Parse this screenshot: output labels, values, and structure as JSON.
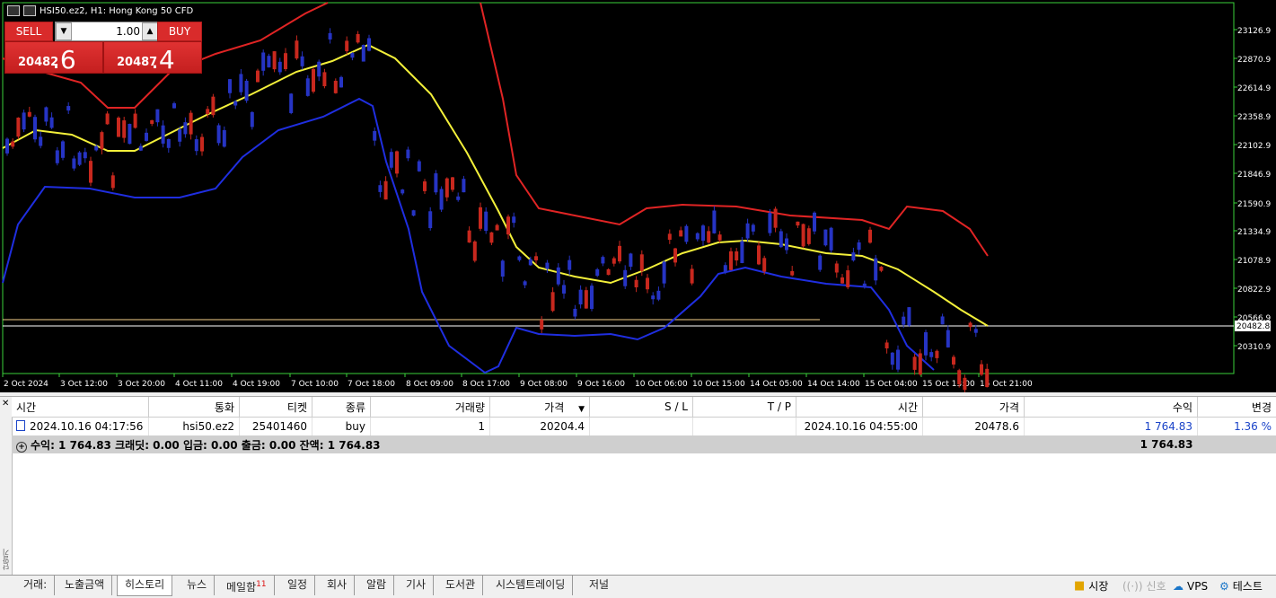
{
  "chart": {
    "title": "HSI50.ez2, H1:  Hong Kong 50 CFD",
    "price_labels": [
      "23126.9",
      "22870.9",
      "22614.9",
      "22358.9",
      "22102.9",
      "21846.9",
      "21590.9",
      "21334.9",
      "21078.9",
      "20822.9",
      "20566.9",
      "20310.9"
    ],
    "current_price_label": "20482.8",
    "time_labels": [
      "2 Oct 2024",
      "3 Oct 12:00",
      "3 Oct 20:00",
      "4 Oct 11:00",
      "4 Oct 19:00",
      "7 Oct 10:00",
      "7 Oct 18:00",
      "8 Oct 09:00",
      "8 Oct 17:00",
      "9 Oct 08:00",
      "9 Oct 16:00",
      "10 Oct 06:00",
      "10 Oct 15:00",
      "14 Oct 05:00",
      "14 Oct 14:00",
      "15 Oct 04:00",
      "15 Oct 13:00",
      "15 Oct 21:00"
    ],
    "colors": {
      "up": "#c8281e",
      "down": "#2634c4",
      "mid": "#f3f03a",
      "upper": "#e02424",
      "lower": "#1f2ee0",
      "grid_axis": "#3ad13a"
    }
  },
  "trade_panel": {
    "sell_label": "SELL",
    "buy_label": "BUY",
    "lot": "1.00",
    "sell_small": "20482",
    "sell_big": ".6",
    "buy_small": "20487",
    "buy_big": ".4"
  },
  "history_table": {
    "headers": [
      "시간",
      "통화",
      "티켓",
      "종류",
      "거래량",
      "가격",
      "S / L",
      "T / P",
      "시간",
      "가격",
      "수익",
      "변경"
    ],
    "row": {
      "time_open": "2024.10.16 04:17:56",
      "symbol": "hsi50.ez2",
      "ticket": "25401460",
      "type": "buy",
      "volume": "1",
      "price_open": "20204.4",
      "sl": "",
      "tp": "",
      "time_close": "2024.10.16 04:55:00",
      "price_close": "20478.6",
      "profit": "1 764.83",
      "change": "1.36 %"
    },
    "summary": "수익: 1 764.83  크래딧: 0.00  입금: 0.00  출금: 0.00  잔액: 1 764.83",
    "summary_total": "1 764.83"
  },
  "tabs": [
    "거래:",
    "노출금액",
    "히스토리",
    "뉴스",
    "메일함",
    "일정",
    "회사",
    "알람",
    "기사",
    "도서관",
    "시스템트레이딩",
    "저널"
  ],
  "mail_badge": "11",
  "status": {
    "market": "시장",
    "signal": "신호",
    "vps": "VPS",
    "test": "테스트"
  },
  "side_label": "단말기"
}
